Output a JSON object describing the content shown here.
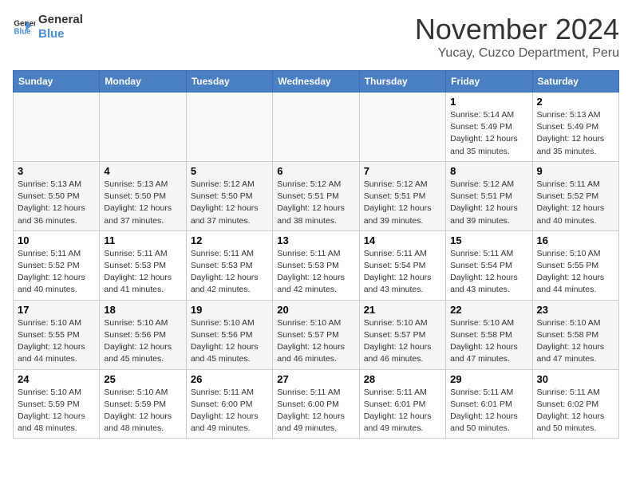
{
  "header": {
    "logo_line1": "General",
    "logo_line2": "Blue",
    "month": "November 2024",
    "location": "Yucay, Cuzco Department, Peru"
  },
  "weekdays": [
    "Sunday",
    "Monday",
    "Tuesday",
    "Wednesday",
    "Thursday",
    "Friday",
    "Saturday"
  ],
  "weeks": [
    [
      {
        "day": "",
        "info": ""
      },
      {
        "day": "",
        "info": ""
      },
      {
        "day": "",
        "info": ""
      },
      {
        "day": "",
        "info": ""
      },
      {
        "day": "",
        "info": ""
      },
      {
        "day": "1",
        "info": "Sunrise: 5:14 AM\nSunset: 5:49 PM\nDaylight: 12 hours\nand 35 minutes."
      },
      {
        "day": "2",
        "info": "Sunrise: 5:13 AM\nSunset: 5:49 PM\nDaylight: 12 hours\nand 35 minutes."
      }
    ],
    [
      {
        "day": "3",
        "info": "Sunrise: 5:13 AM\nSunset: 5:50 PM\nDaylight: 12 hours\nand 36 minutes."
      },
      {
        "day": "4",
        "info": "Sunrise: 5:13 AM\nSunset: 5:50 PM\nDaylight: 12 hours\nand 37 minutes."
      },
      {
        "day": "5",
        "info": "Sunrise: 5:12 AM\nSunset: 5:50 PM\nDaylight: 12 hours\nand 37 minutes."
      },
      {
        "day": "6",
        "info": "Sunrise: 5:12 AM\nSunset: 5:51 PM\nDaylight: 12 hours\nand 38 minutes."
      },
      {
        "day": "7",
        "info": "Sunrise: 5:12 AM\nSunset: 5:51 PM\nDaylight: 12 hours\nand 39 minutes."
      },
      {
        "day": "8",
        "info": "Sunrise: 5:12 AM\nSunset: 5:51 PM\nDaylight: 12 hours\nand 39 minutes."
      },
      {
        "day": "9",
        "info": "Sunrise: 5:11 AM\nSunset: 5:52 PM\nDaylight: 12 hours\nand 40 minutes."
      }
    ],
    [
      {
        "day": "10",
        "info": "Sunrise: 5:11 AM\nSunset: 5:52 PM\nDaylight: 12 hours\nand 40 minutes."
      },
      {
        "day": "11",
        "info": "Sunrise: 5:11 AM\nSunset: 5:53 PM\nDaylight: 12 hours\nand 41 minutes."
      },
      {
        "day": "12",
        "info": "Sunrise: 5:11 AM\nSunset: 5:53 PM\nDaylight: 12 hours\nand 42 minutes."
      },
      {
        "day": "13",
        "info": "Sunrise: 5:11 AM\nSunset: 5:53 PM\nDaylight: 12 hours\nand 42 minutes."
      },
      {
        "day": "14",
        "info": "Sunrise: 5:11 AM\nSunset: 5:54 PM\nDaylight: 12 hours\nand 43 minutes."
      },
      {
        "day": "15",
        "info": "Sunrise: 5:11 AM\nSunset: 5:54 PM\nDaylight: 12 hours\nand 43 minutes."
      },
      {
        "day": "16",
        "info": "Sunrise: 5:10 AM\nSunset: 5:55 PM\nDaylight: 12 hours\nand 44 minutes."
      }
    ],
    [
      {
        "day": "17",
        "info": "Sunrise: 5:10 AM\nSunset: 5:55 PM\nDaylight: 12 hours\nand 44 minutes."
      },
      {
        "day": "18",
        "info": "Sunrise: 5:10 AM\nSunset: 5:56 PM\nDaylight: 12 hours\nand 45 minutes."
      },
      {
        "day": "19",
        "info": "Sunrise: 5:10 AM\nSunset: 5:56 PM\nDaylight: 12 hours\nand 45 minutes."
      },
      {
        "day": "20",
        "info": "Sunrise: 5:10 AM\nSunset: 5:57 PM\nDaylight: 12 hours\nand 46 minutes."
      },
      {
        "day": "21",
        "info": "Sunrise: 5:10 AM\nSunset: 5:57 PM\nDaylight: 12 hours\nand 46 minutes."
      },
      {
        "day": "22",
        "info": "Sunrise: 5:10 AM\nSunset: 5:58 PM\nDaylight: 12 hours\nand 47 minutes."
      },
      {
        "day": "23",
        "info": "Sunrise: 5:10 AM\nSunset: 5:58 PM\nDaylight: 12 hours\nand 47 minutes."
      }
    ],
    [
      {
        "day": "24",
        "info": "Sunrise: 5:10 AM\nSunset: 5:59 PM\nDaylight: 12 hours\nand 48 minutes."
      },
      {
        "day": "25",
        "info": "Sunrise: 5:10 AM\nSunset: 5:59 PM\nDaylight: 12 hours\nand 48 minutes."
      },
      {
        "day": "26",
        "info": "Sunrise: 5:11 AM\nSunset: 6:00 PM\nDaylight: 12 hours\nand 49 minutes."
      },
      {
        "day": "27",
        "info": "Sunrise: 5:11 AM\nSunset: 6:00 PM\nDaylight: 12 hours\nand 49 minutes."
      },
      {
        "day": "28",
        "info": "Sunrise: 5:11 AM\nSunset: 6:01 PM\nDaylight: 12 hours\nand 49 minutes."
      },
      {
        "day": "29",
        "info": "Sunrise: 5:11 AM\nSunset: 6:01 PM\nDaylight: 12 hours\nand 50 minutes."
      },
      {
        "day": "30",
        "info": "Sunrise: 5:11 AM\nSunset: 6:02 PM\nDaylight: 12 hours\nand 50 minutes."
      }
    ]
  ]
}
